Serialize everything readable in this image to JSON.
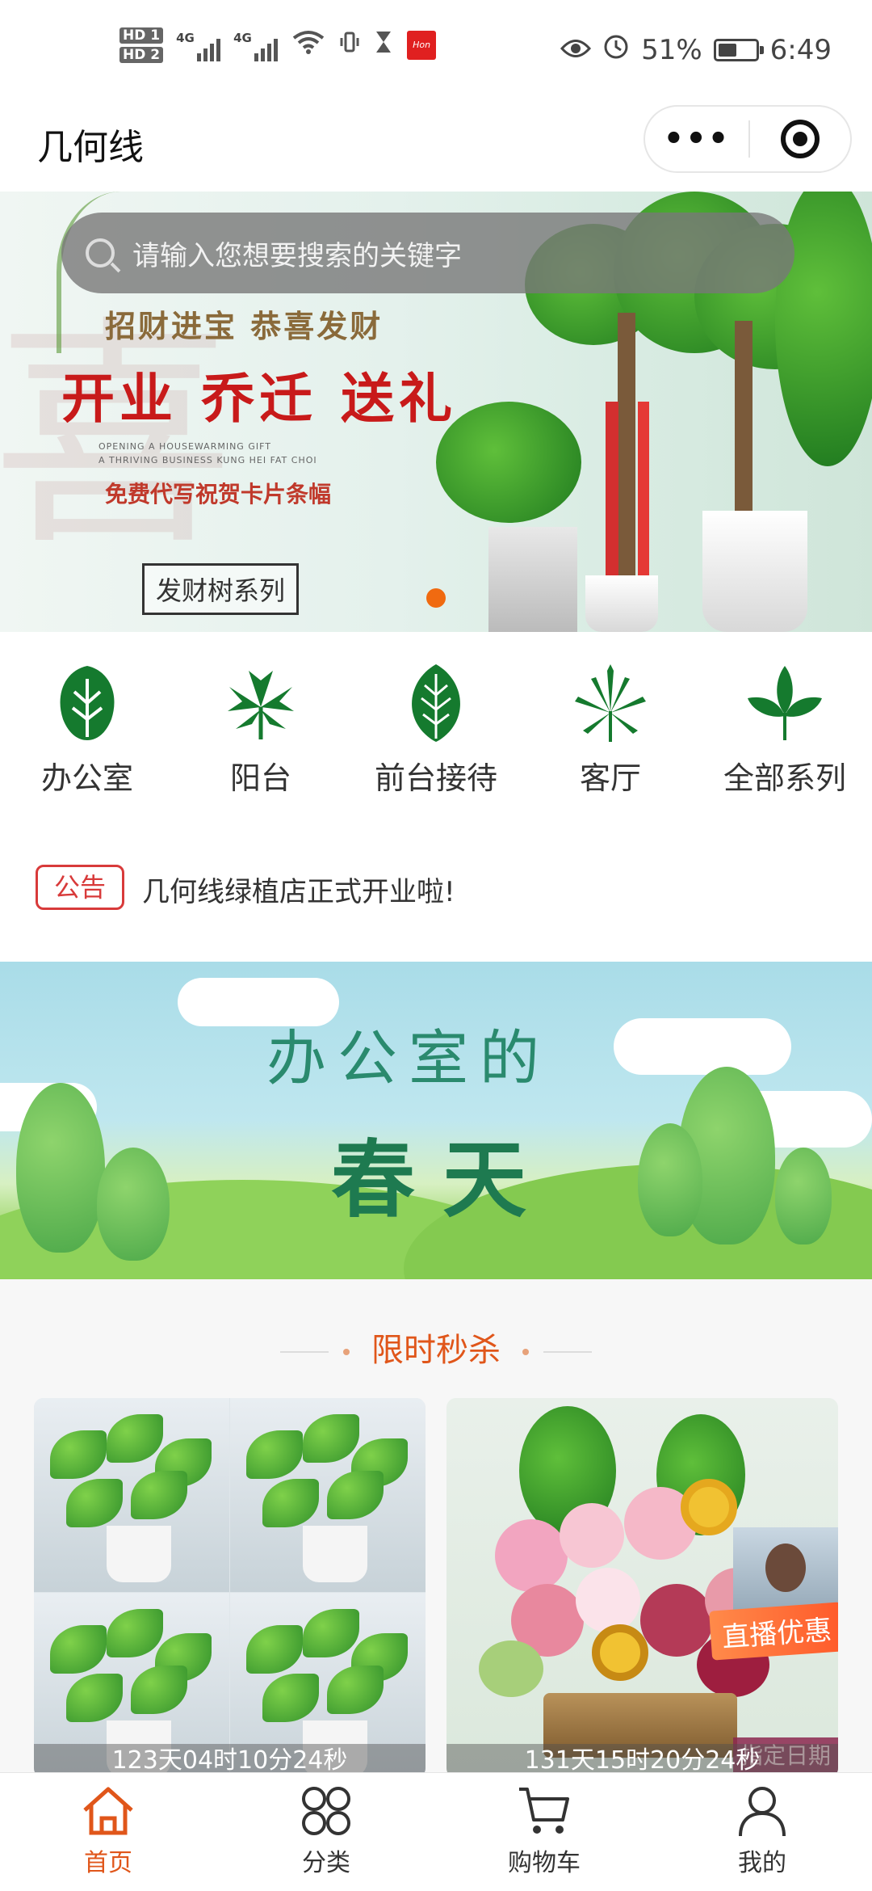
{
  "status_bar": {
    "hd1": "HD 1",
    "hd2": "HD 2",
    "signal1": "4G",
    "signal2": "4G",
    "battery_percent": "51%",
    "battery_level": 0.51,
    "time": "6:49"
  },
  "header": {
    "title": "几何线",
    "more_icon": "more-dots-icon",
    "close_icon": "target-icon"
  },
  "search": {
    "placeholder": "请输入您想要搜索的关键字"
  },
  "banner": {
    "subtitle": "招财进宝  恭喜发财",
    "headline": "开业 乔迁 送礼",
    "english_line1": "OPENING A HOUSEWARMING GIFT",
    "english_line2": "A THRIVING BUSINESS KUNG HEI FAT CHOI",
    "free_text": "免费代写祝贺卡片条幅",
    "series_label": "发财树系列",
    "active_slide": 1
  },
  "categories": [
    {
      "label": "办公室",
      "icon": "leaf-oval-icon"
    },
    {
      "label": "阳台",
      "icon": "palm-leaf-icon"
    },
    {
      "label": "前台接待",
      "icon": "leaf-round-icon"
    },
    {
      "label": "客厅",
      "icon": "star-leaf-icon"
    },
    {
      "label": "全部系列",
      "icon": "triple-leaf-icon"
    }
  ],
  "notice": {
    "tag": "公告",
    "text": "几何线绿植店正式开业啦!"
  },
  "promo_banner": {
    "line1": "办公室的",
    "line2": "春天"
  },
  "flash_sale": {
    "title": "限时秒杀",
    "products": [
      {
        "countdown": "123天04时10分24秒"
      },
      {
        "countdown": "131天15时20分24秒",
        "badge": "直播优惠",
        "date_tag": "指定日期"
      }
    ]
  },
  "tab_bar": [
    {
      "label": "首页",
      "icon": "home-icon",
      "active": true
    },
    {
      "label": "分类",
      "icon": "category-icon",
      "active": false
    },
    {
      "label": "购物车",
      "icon": "cart-icon",
      "active": false
    },
    {
      "label": "我的",
      "icon": "user-icon",
      "active": false
    }
  ],
  "colors": {
    "accent": "#e0561a",
    "notice_red": "#d83a3a",
    "leaf_green": "#157a2e"
  }
}
